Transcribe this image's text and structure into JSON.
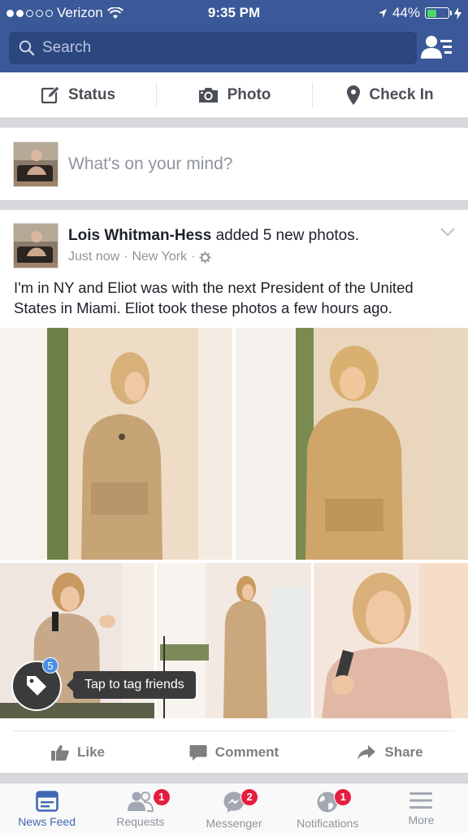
{
  "status_bar": {
    "carrier": "Verizon",
    "time": "9:35 PM",
    "battery": "44%",
    "battery_level": 0.44
  },
  "search": {
    "placeholder": "Search"
  },
  "composer": {
    "status_label": "Status",
    "photo_label": "Photo",
    "checkin_label": "Check In",
    "prompt": "What's on your mind?"
  },
  "post": {
    "author": "Lois Whitman-Hess",
    "action": " added 5 new photos.",
    "time": "Just now",
    "location": "New York",
    "text": "I'm in NY and Eliot was with the next President of the United States in Miami. Eliot took these photos a few hours ago.",
    "tag_count": "5",
    "tag_tip": "Tap to tag friends",
    "like_label": "Like",
    "comment_label": "Comment",
    "share_label": "Share"
  },
  "tabs": [
    {
      "label": "News Feed",
      "badge": ""
    },
    {
      "label": "Requests",
      "badge": "1"
    },
    {
      "label": "Messenger",
      "badge": "2"
    },
    {
      "label": "Notifications",
      "badge": "1"
    },
    {
      "label": "More",
      "badge": ""
    }
  ],
  "colors": {
    "brand": "#3b5998",
    "active_tab": "#4267b2",
    "badge": "#e41e3f",
    "battery_fill": "#4cd964"
  }
}
